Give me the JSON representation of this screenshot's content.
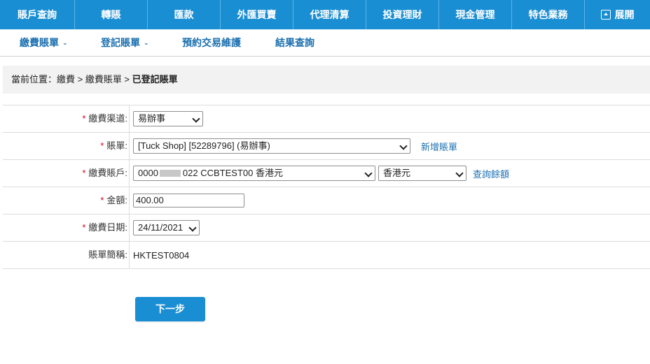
{
  "topnav": {
    "items": [
      "賬戶查詢",
      "轉賬",
      "匯款",
      "外匯買賣",
      "代理清算",
      "投資理財",
      "現金管理",
      "特色業務"
    ],
    "expand_label": "展開"
  },
  "subnav": {
    "items": [
      "繳費賬單",
      "登記賬單",
      "預約交易維護",
      "結果查詢"
    ],
    "caret": "⌄"
  },
  "breadcrumb": {
    "prefix": "當前位置：繳費 > 繳費賬單 > ",
    "current": "已登記賬單"
  },
  "form": {
    "required_mark": "*",
    "channel": {
      "label": "繳費渠道:",
      "value": "易辦事"
    },
    "bill": {
      "label": "賬單:",
      "value": "[Tuck Shop] [52289796] (易辦事)",
      "link": "新增賬單"
    },
    "account": {
      "label": "繳費賬戶:",
      "value_prefix": "0000",
      "value_suffix": "022 CCBTEST00 香港元",
      "currency": "香港元",
      "link": "查詢餘額"
    },
    "amount": {
      "label": "金額:",
      "value": "400.00"
    },
    "date": {
      "label": "繳費日期:",
      "value": "24/11/2021"
    },
    "nickname": {
      "label": "賬單簡稱:",
      "value": "HKTEST0804"
    }
  },
  "actions": {
    "next_label": "下一步"
  },
  "colors": {
    "primary": "#1a8ed3",
    "link": "#1a6fb0",
    "required": "#d0021b"
  }
}
